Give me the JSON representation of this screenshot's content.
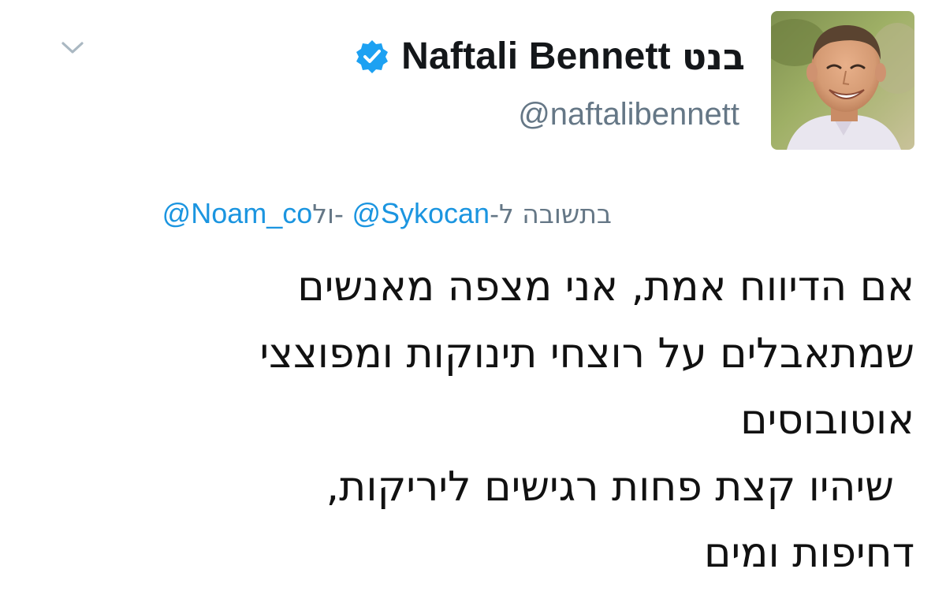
{
  "tweet": {
    "author": {
      "display_name": "Naftali Bennett",
      "display_name_hebrew": "בנט",
      "handle": "@naftalibennett",
      "verified_icon": "verified-badge-icon",
      "avatar": "profile-photo"
    },
    "menu_icon": "chevron-down-icon",
    "reply_context": {
      "prefix": "בתשובה ל-",
      "mention_1": "@Sykocan",
      "joiner": "-ול",
      "mention_2": "@Noam_co"
    },
    "body_lines": [
      "אם הדיווח אמת, אני מצפה מאנשים",
      "שמתאבלים על רוצחי תינוקות ומפוצצי",
      "אוטובוסים",
      " שיהיו קצת פחות רגישים ליריקות,",
      "דחיפות ומים"
    ]
  },
  "colors": {
    "text_primary": "#14171a",
    "text_secondary": "#657786",
    "link": "#1b95e0",
    "verified": "#1da1f2",
    "background": "#ffffff"
  }
}
